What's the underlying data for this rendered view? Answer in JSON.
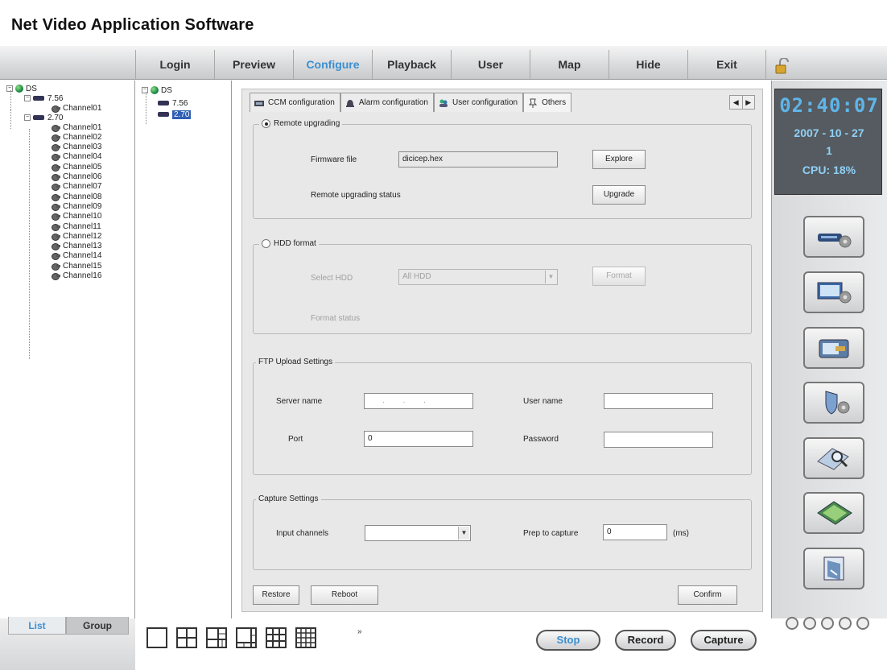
{
  "app": {
    "title": "Net Video Application Software"
  },
  "menu": {
    "items": [
      "Login",
      "Preview",
      "Configure",
      "Playback",
      "User",
      "Map",
      "Hide",
      "Exit"
    ],
    "active": "Configure"
  },
  "tree_left": {
    "root": "DS",
    "devices": [
      {
        "name": "7.56",
        "channels": [
          "Channel01"
        ]
      },
      {
        "name": "2.70",
        "channels": [
          "Channel01",
          "Channel02",
          "Channel03",
          "Channel04",
          "Channel05",
          "Channel06",
          "Channel07",
          "Channel08",
          "Channel09",
          "Channel10",
          "Channel11",
          "Channel12",
          "Channel13",
          "Channel14",
          "Channel15",
          "Channel16"
        ]
      }
    ]
  },
  "tree_right": {
    "root": "DS",
    "devices": [
      "7.56",
      "2.70"
    ],
    "selected": "2.70"
  },
  "tabs": {
    "items": [
      "CCM configuration",
      "Alarm configuration",
      "User configuration",
      "Others"
    ],
    "active": "Others"
  },
  "remote_upgrading": {
    "title": "Remote upgrading",
    "selected": true,
    "firmware_label": "Firmware file",
    "firmware_value": "dicicep.hex",
    "explore_label": "Explore",
    "status_label": "Remote upgrading status",
    "upgrade_label": "Upgrade"
  },
  "hdd_format": {
    "title": "HDD format",
    "selected": false,
    "select_label": "Select HDD",
    "select_value": "All HDD",
    "format_label": "Format",
    "status_label": "Format status"
  },
  "ftp": {
    "title": "FTP Upload Settings",
    "server_label": "Server name",
    "server_value": ". . .",
    "user_label": "User name",
    "user_value": "",
    "port_label": "Port",
    "port_value": "0",
    "password_label": "Password",
    "password_value": ""
  },
  "capture": {
    "title": "Capture Settings",
    "input_label": "Input channels",
    "input_value": "",
    "prep_label": "Prep to capture",
    "prep_value": "0",
    "unit": "(ms)"
  },
  "footer_buttons": {
    "restore": "Restore",
    "reboot": "Reboot",
    "confirm": "Confirm"
  },
  "status": {
    "time": "02:40:07",
    "date": "2007 - 10 - 27",
    "day": "1",
    "cpu": "CPU: 18%"
  },
  "bottom": {
    "list_tab": "List",
    "group_tab": "Group",
    "more": "»",
    "stop": "Stop",
    "record": "Record",
    "capture": "Capture"
  },
  "side_icons": [
    "device-config-icon",
    "monitor-config-icon",
    "network-icon",
    "security-icon",
    "search-icon",
    "map-board-icon",
    "exit-door-icon"
  ],
  "colors": {
    "accent": "#3a8fd1",
    "clock_bg": "#555b60",
    "clock_text": "#5fb5e8"
  }
}
